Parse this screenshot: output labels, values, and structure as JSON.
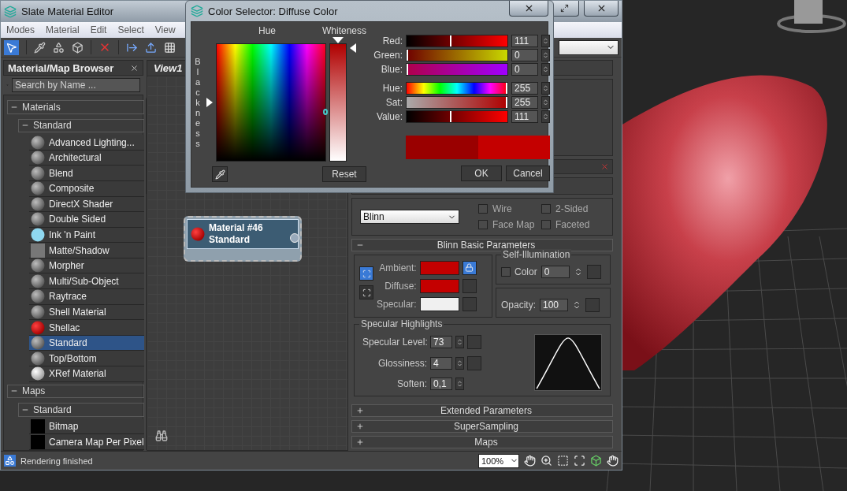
{
  "editor_window": {
    "title": "Slate Material Editor",
    "menu": [
      "Modes",
      "Material",
      "Edit",
      "Select",
      "View"
    ]
  },
  "browser": {
    "title": "Material/Map Browser",
    "search": {
      "placeholder": "Search by Name ..."
    },
    "groups": [
      {
        "label": "Materials",
        "expanded": true,
        "children": [
          {
            "label": "Standard",
            "expanded": true,
            "items": [
              {
                "label": "Advanced Lighting...",
                "kind": "sphere",
                "selected": false
              },
              {
                "label": "Architectural",
                "kind": "sphere",
                "selected": false
              },
              {
                "label": "Blend",
                "kind": "sphere",
                "selected": false
              },
              {
                "label": "Composite",
                "kind": "sphere",
                "selected": false
              },
              {
                "label": "DirectX Shader",
                "kind": "sphere",
                "selected": false
              },
              {
                "label": "Double Sided",
                "kind": "sphere",
                "selected": false
              },
              {
                "label": "Ink 'n Paint",
                "kind": "toon",
                "selected": false
              },
              {
                "label": "Matte/Shadow",
                "kind": "flat",
                "selected": false
              },
              {
                "label": "Morpher",
                "kind": "sphere",
                "selected": false
              },
              {
                "label": "Multi/Sub-Object",
                "kind": "sphere",
                "selected": false
              },
              {
                "label": "Raytrace",
                "kind": "sphere",
                "selected": false
              },
              {
                "label": "Shell Material",
                "kind": "sphere",
                "selected": false
              },
              {
                "label": "Shellac",
                "kind": "shellac",
                "selected": false
              },
              {
                "label": "Standard",
                "kind": "sphere",
                "selected": true
              },
              {
                "label": "Top/Bottom",
                "kind": "sphere",
                "selected": false
              },
              {
                "label": "XRef Material",
                "kind": "white",
                "selected": false
              }
            ]
          }
        ]
      },
      {
        "label": "Maps",
        "expanded": true,
        "children": [
          {
            "label": "Standard",
            "expanded": true,
            "items": [
              {
                "label": "Bitmap",
                "kind": "map",
                "selected": false
              },
              {
                "label": "Camera Map Per Pixel",
                "kind": "map",
                "selected": false
              }
            ]
          }
        ]
      }
    ]
  },
  "view": {
    "tab": "View1",
    "node": {
      "title": "Material #46",
      "subtitle": "Standard"
    }
  },
  "params": {
    "shader": "Blinn",
    "options": [
      {
        "label": "Wire",
        "checked": false
      },
      {
        "label": "2-Sided",
        "checked": false
      },
      {
        "label": "Face Map",
        "checked": false
      },
      {
        "label": "Faceted",
        "checked": false
      }
    ],
    "basic_rollout": {
      "title": "Blinn Basic Parameters",
      "expanded": true,
      "colors": [
        {
          "label": "Ambient:",
          "color": "#c40000"
        },
        {
          "label": "Diffuse:",
          "color": "#c40000"
        },
        {
          "label": "Specular:",
          "color": "#f0f0f0"
        }
      ],
      "self_illumination": {
        "title": "Self-Illumination",
        "label": "Color",
        "checked": false,
        "value": "0"
      },
      "opacity": {
        "label": "Opacity:",
        "value": "100"
      },
      "highlights": {
        "title": "Specular Highlights",
        "fields": [
          {
            "label": "Specular Level:",
            "value": "73",
            "map_slot": true
          },
          {
            "label": "Glossiness:",
            "value": "4",
            "map_slot": true
          },
          {
            "label": "Soften:",
            "value": "0,1",
            "map_slot": false
          }
        ]
      }
    },
    "rollouts": [
      {
        "title": "Extended Parameters",
        "expanded": false
      },
      {
        "title": "SuperSampling",
        "expanded": false
      },
      {
        "title": "Maps",
        "expanded": false
      }
    ]
  },
  "status_bar": {
    "message": "Rendering finished",
    "zoom": "100%"
  },
  "color_dialog": {
    "title": "Color Selector: Diffuse Color",
    "hue_label": "Hue",
    "whiteness_label": "Whiteness",
    "blackness_label": "Blackness",
    "channels": [
      {
        "label": "Red:",
        "value": "111",
        "level": 0.435,
        "kind": "red"
      },
      {
        "label": "Green:",
        "value": "0",
        "level": 0,
        "kind": "green"
      },
      {
        "label": "Blue:",
        "value": "0",
        "level": 0,
        "kind": "blue"
      },
      {
        "label": "Hue:",
        "value": "255",
        "level": 1,
        "kind": "hue"
      },
      {
        "label": "Sat:",
        "value": "255",
        "level": 1,
        "kind": "sat"
      },
      {
        "label": "Value:",
        "value": "111",
        "level": 0.435,
        "kind": "value"
      }
    ],
    "preview": [
      {
        "color": "#9a0000"
      },
      {
        "color": "#c40000"
      }
    ],
    "buttons": {
      "reset": "Reset",
      "ok": "OK",
      "cancel": "Cancel"
    }
  }
}
